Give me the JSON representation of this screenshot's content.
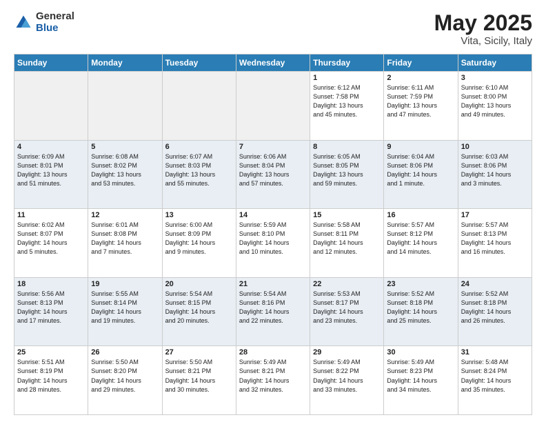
{
  "header": {
    "logo_general": "General",
    "logo_blue": "Blue",
    "title": "May 2025",
    "location": "Vita, Sicily, Italy"
  },
  "days_of_week": [
    "Sunday",
    "Monday",
    "Tuesday",
    "Wednesday",
    "Thursday",
    "Friday",
    "Saturday"
  ],
  "weeks": [
    [
      {
        "day": "",
        "empty": true
      },
      {
        "day": "",
        "empty": true
      },
      {
        "day": "",
        "empty": true
      },
      {
        "day": "",
        "empty": true
      },
      {
        "day": "1",
        "info": "Sunrise: 6:12 AM\nSunset: 7:58 PM\nDaylight: 13 hours\nand 45 minutes."
      },
      {
        "day": "2",
        "info": "Sunrise: 6:11 AM\nSunset: 7:59 PM\nDaylight: 13 hours\nand 47 minutes."
      },
      {
        "day": "3",
        "info": "Sunrise: 6:10 AM\nSunset: 8:00 PM\nDaylight: 13 hours\nand 49 minutes."
      }
    ],
    [
      {
        "day": "4",
        "info": "Sunrise: 6:09 AM\nSunset: 8:01 PM\nDaylight: 13 hours\nand 51 minutes."
      },
      {
        "day": "5",
        "info": "Sunrise: 6:08 AM\nSunset: 8:02 PM\nDaylight: 13 hours\nand 53 minutes."
      },
      {
        "day": "6",
        "info": "Sunrise: 6:07 AM\nSunset: 8:03 PM\nDaylight: 13 hours\nand 55 minutes."
      },
      {
        "day": "7",
        "info": "Sunrise: 6:06 AM\nSunset: 8:04 PM\nDaylight: 13 hours\nand 57 minutes."
      },
      {
        "day": "8",
        "info": "Sunrise: 6:05 AM\nSunset: 8:05 PM\nDaylight: 13 hours\nand 59 minutes."
      },
      {
        "day": "9",
        "info": "Sunrise: 6:04 AM\nSunset: 8:06 PM\nDaylight: 14 hours\nand 1 minute."
      },
      {
        "day": "10",
        "info": "Sunrise: 6:03 AM\nSunset: 8:06 PM\nDaylight: 14 hours\nand 3 minutes."
      }
    ],
    [
      {
        "day": "11",
        "info": "Sunrise: 6:02 AM\nSunset: 8:07 PM\nDaylight: 14 hours\nand 5 minutes."
      },
      {
        "day": "12",
        "info": "Sunrise: 6:01 AM\nSunset: 8:08 PM\nDaylight: 14 hours\nand 7 minutes."
      },
      {
        "day": "13",
        "info": "Sunrise: 6:00 AM\nSunset: 8:09 PM\nDaylight: 14 hours\nand 9 minutes."
      },
      {
        "day": "14",
        "info": "Sunrise: 5:59 AM\nSunset: 8:10 PM\nDaylight: 14 hours\nand 10 minutes."
      },
      {
        "day": "15",
        "info": "Sunrise: 5:58 AM\nSunset: 8:11 PM\nDaylight: 14 hours\nand 12 minutes."
      },
      {
        "day": "16",
        "info": "Sunrise: 5:57 AM\nSunset: 8:12 PM\nDaylight: 14 hours\nand 14 minutes."
      },
      {
        "day": "17",
        "info": "Sunrise: 5:57 AM\nSunset: 8:13 PM\nDaylight: 14 hours\nand 16 minutes."
      }
    ],
    [
      {
        "day": "18",
        "info": "Sunrise: 5:56 AM\nSunset: 8:13 PM\nDaylight: 14 hours\nand 17 minutes."
      },
      {
        "day": "19",
        "info": "Sunrise: 5:55 AM\nSunset: 8:14 PM\nDaylight: 14 hours\nand 19 minutes."
      },
      {
        "day": "20",
        "info": "Sunrise: 5:54 AM\nSunset: 8:15 PM\nDaylight: 14 hours\nand 20 minutes."
      },
      {
        "day": "21",
        "info": "Sunrise: 5:54 AM\nSunset: 8:16 PM\nDaylight: 14 hours\nand 22 minutes."
      },
      {
        "day": "22",
        "info": "Sunrise: 5:53 AM\nSunset: 8:17 PM\nDaylight: 14 hours\nand 23 minutes."
      },
      {
        "day": "23",
        "info": "Sunrise: 5:52 AM\nSunset: 8:18 PM\nDaylight: 14 hours\nand 25 minutes."
      },
      {
        "day": "24",
        "info": "Sunrise: 5:52 AM\nSunset: 8:18 PM\nDaylight: 14 hours\nand 26 minutes."
      }
    ],
    [
      {
        "day": "25",
        "info": "Sunrise: 5:51 AM\nSunset: 8:19 PM\nDaylight: 14 hours\nand 28 minutes."
      },
      {
        "day": "26",
        "info": "Sunrise: 5:50 AM\nSunset: 8:20 PM\nDaylight: 14 hours\nand 29 minutes."
      },
      {
        "day": "27",
        "info": "Sunrise: 5:50 AM\nSunset: 8:21 PM\nDaylight: 14 hours\nand 30 minutes."
      },
      {
        "day": "28",
        "info": "Sunrise: 5:49 AM\nSunset: 8:21 PM\nDaylight: 14 hours\nand 32 minutes."
      },
      {
        "day": "29",
        "info": "Sunrise: 5:49 AM\nSunset: 8:22 PM\nDaylight: 14 hours\nand 33 minutes."
      },
      {
        "day": "30",
        "info": "Sunrise: 5:49 AM\nSunset: 8:23 PM\nDaylight: 14 hours\nand 34 minutes."
      },
      {
        "day": "31",
        "info": "Sunrise: 5:48 AM\nSunset: 8:24 PM\nDaylight: 14 hours\nand 35 minutes."
      }
    ]
  ]
}
